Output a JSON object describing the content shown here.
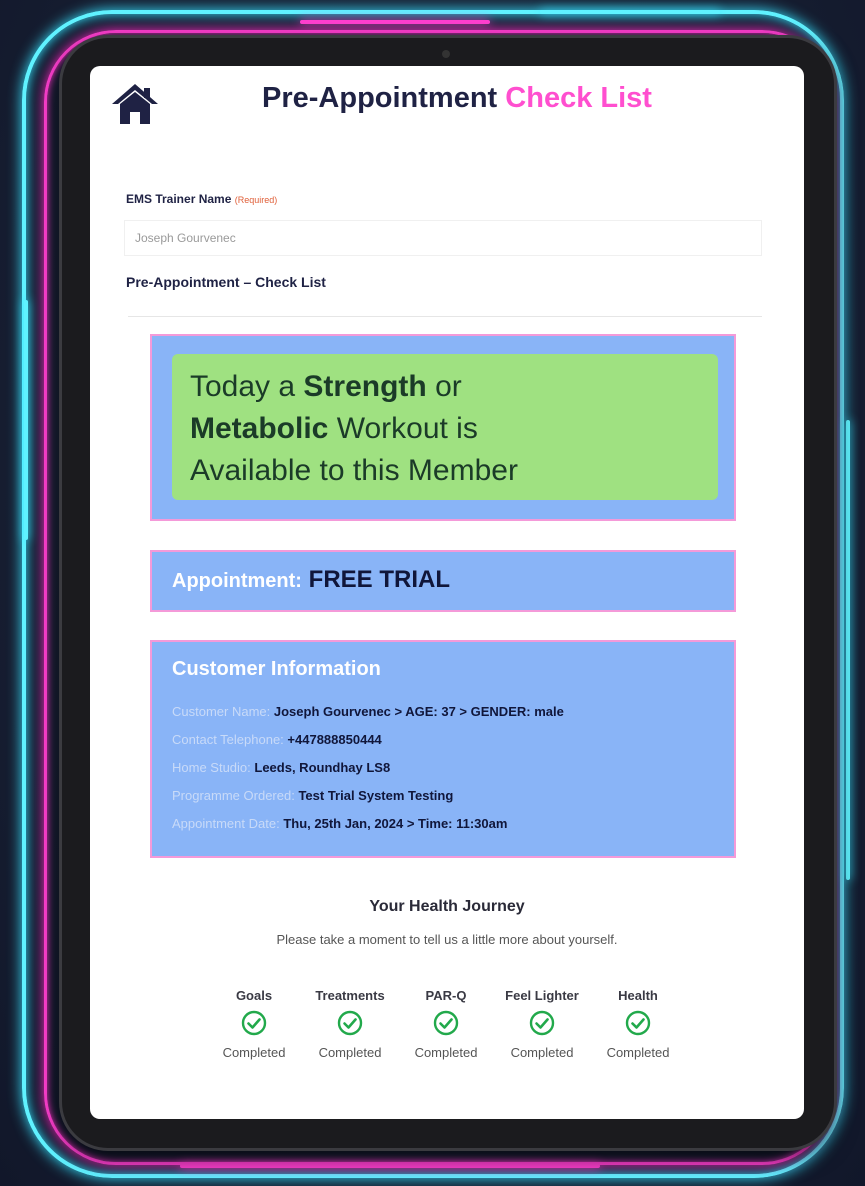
{
  "header": {
    "title_main": "Pre-Appointment",
    "title_accent": "Check List",
    "accent_color": "#ff4fcf"
  },
  "form": {
    "trainer_label": "EMS Trainer Name",
    "trainer_required": "(Required)",
    "trainer_value": "Joseph Gourvenec",
    "checklist_heading": "Pre-Appointment – Check List"
  },
  "workout": {
    "line1_pre": "Today a ",
    "line1_bold": "Strength",
    "line1_post": " or",
    "line2_bold": "Metabolic",
    "line2_post": " Workout is",
    "line3": "Available to this Member"
  },
  "appointment": {
    "label": "Appointment:",
    "value": "FREE TRIAL"
  },
  "customer": {
    "title": "Customer Information",
    "rows": [
      {
        "label": "Customer Name:",
        "value": "Joseph Gourvenec > AGE: 37 > GENDER: male"
      },
      {
        "label": "Contact Telephone:",
        "value": "+447888850444"
      },
      {
        "label": "Home Studio:",
        "value": "Leeds, Roundhay LS8"
      },
      {
        "label": "Programme Ordered:",
        "value": "Test Trial System Testing"
      },
      {
        "label": "Appointment Date:",
        "value": "Thu, 25th Jan, 2024 > Time: 11:30am"
      }
    ]
  },
  "journey": {
    "title": "Your Health Journey",
    "subtitle": "Please take a moment to tell us a little more about yourself.",
    "steps": [
      {
        "name": "Goals",
        "status": "Completed",
        "icon": "check-circle-icon"
      },
      {
        "name": "Treatments",
        "status": "Completed",
        "icon": "check-circle-icon"
      },
      {
        "name": "PAR-Q",
        "status": "Completed",
        "icon": "check-circle-icon"
      },
      {
        "name": "Feel Lighter",
        "status": "Completed",
        "icon": "check-circle-icon"
      },
      {
        "name": "Health",
        "status": "Completed",
        "icon": "check-circle-icon"
      }
    ]
  },
  "colors": {
    "panel_blue": "#89b4f7",
    "panel_green": "#9fe181",
    "check_green": "#22a94b",
    "neon_cyan": "#5ff2ff",
    "neon_pink": "#ff3fd0"
  }
}
